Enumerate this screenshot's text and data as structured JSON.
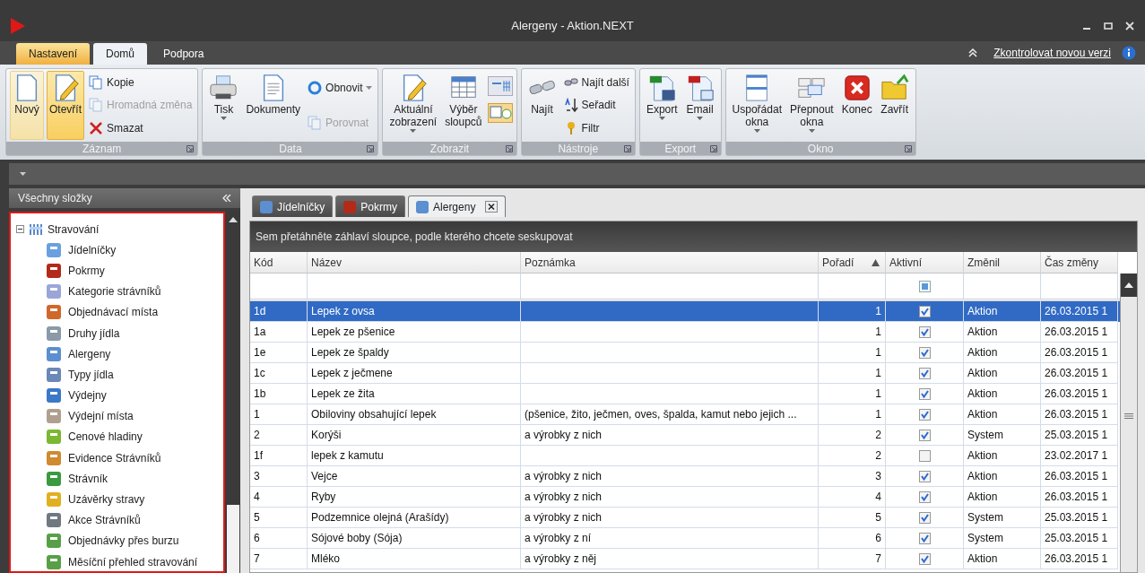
{
  "window": {
    "title": "Alergeny - Aktion.NEXT"
  },
  "ribbon_tabs": [
    {
      "label": "Nastavení",
      "selected": false,
      "contextual": true
    },
    {
      "label": "Domů",
      "selected": true,
      "contextual": false
    },
    {
      "label": "Podpora",
      "selected": false,
      "contextual": false
    }
  ],
  "update_link": "Zkontrolovat novou verzi",
  "ribbon_groups": [
    {
      "title": "Záznam",
      "buttons": [
        {
          "kind": "large",
          "label": "Nový",
          "hot": true,
          "pressed": false,
          "dropdown": false,
          "disabled": false
        },
        {
          "kind": "large",
          "label": "Otevřít",
          "hot": false,
          "pressed": true,
          "dropdown": false,
          "disabled": false
        },
        {
          "kind": "small",
          "label": "Kopie",
          "dropdown": false,
          "disabled": false
        },
        {
          "kind": "small",
          "label": "Hromadná změna",
          "dropdown": false,
          "disabled": true
        },
        {
          "kind": "small",
          "label": "Smazat",
          "dropdown": false,
          "disabled": false
        }
      ]
    },
    {
      "title": "Data",
      "buttons": [
        {
          "kind": "large",
          "label": "Tisk",
          "hot": false,
          "pressed": false,
          "dropdown": true,
          "disabled": false
        },
        {
          "kind": "large",
          "label": "Dokumenty",
          "hot": false,
          "pressed": false,
          "dropdown": false,
          "disabled": false
        },
        {
          "kind": "small",
          "label": "Obnovit",
          "dropdown": true,
          "disabled": false
        },
        {
          "kind": "small",
          "label": "Porovnat",
          "dropdown": false,
          "disabled": true
        }
      ]
    },
    {
      "title": "Zobrazit",
      "buttons": [
        {
          "kind": "large",
          "label": "Aktuální\nzobrazení",
          "hot": false,
          "pressed": false,
          "dropdown": true,
          "disabled": false
        },
        {
          "kind": "large",
          "label": "Výběr\nsloupců",
          "hot": false,
          "pressed": false,
          "dropdown": false,
          "disabled": false
        },
        {
          "kind": "iconpair"
        }
      ]
    },
    {
      "title": "Nástroje",
      "buttons": [
        {
          "kind": "large",
          "label": "Najít",
          "hot": false,
          "pressed": false,
          "dropdown": false,
          "disabled": false
        },
        {
          "kind": "small",
          "label": "Najít další",
          "dropdown": false,
          "disabled": false
        },
        {
          "kind": "small",
          "label": "Seřadit",
          "dropdown": false,
          "disabled": false
        },
        {
          "kind": "small",
          "label": "Filtr",
          "dropdown": false,
          "disabled": false
        }
      ]
    },
    {
      "title": "Export",
      "buttons": [
        {
          "kind": "large",
          "label": "Export",
          "hot": false,
          "pressed": false,
          "dropdown": true,
          "disabled": false
        },
        {
          "kind": "large",
          "label": "Email",
          "hot": false,
          "pressed": false,
          "dropdown": true,
          "disabled": false
        }
      ]
    },
    {
      "title": "Okno",
      "buttons": [
        {
          "kind": "large",
          "label": "Uspořádat\nokna",
          "hot": false,
          "pressed": false,
          "dropdown": true,
          "disabled": false
        },
        {
          "kind": "large",
          "label": "Přepnout\nokna",
          "hot": false,
          "pressed": false,
          "dropdown": true,
          "disabled": false
        },
        {
          "kind": "large",
          "label": "Konec",
          "hot": false,
          "pressed": false,
          "dropdown": false,
          "disabled": false
        },
        {
          "kind": "large",
          "label": "Zavřít",
          "hot": false,
          "pressed": false,
          "dropdown": false,
          "disabled": false
        }
      ]
    }
  ],
  "sidebar": {
    "title": "Všechny složky",
    "tree": [
      {
        "label": "Stravování",
        "expanded": true,
        "children": [
          {
            "label": "Jídelníčky"
          },
          {
            "label": "Pokrmy"
          },
          {
            "label": "Kategorie strávníků"
          },
          {
            "label": "Objednávací místa"
          },
          {
            "label": "Druhy jídla"
          },
          {
            "label": "Alergeny"
          },
          {
            "label": "Typy jídla"
          },
          {
            "label": "Výdejny"
          },
          {
            "label": "Výdejní místa"
          },
          {
            "label": "Cenové hladiny"
          },
          {
            "label": "Evidence Strávníků"
          },
          {
            "label": "Strávník"
          },
          {
            "label": "Uzávěrky stravy"
          },
          {
            "label": "Akce Strávníků"
          },
          {
            "label": "Objednávky přes burzu"
          },
          {
            "label": "Měsíční přehled stravování"
          }
        ]
      }
    ]
  },
  "doc_tabs": [
    {
      "label": "Jídelníčky",
      "selected": false,
      "closable": false
    },
    {
      "label": "Pokrmy",
      "selected": false,
      "closable": false
    },
    {
      "label": "Alergeny",
      "selected": true,
      "closable": true
    }
  ],
  "group_panel": "Sem přetáhněte záhlaví sloupce, podle kterého chcete seskupovat",
  "table": {
    "columns": [
      {
        "label": "Kód",
        "sorted": false
      },
      {
        "label": "Název",
        "sorted": false
      },
      {
        "label": "Poznámka",
        "sorted": false
      },
      {
        "label": "Pořadí",
        "sorted": true
      },
      {
        "label": "Aktivní",
        "sorted": false
      },
      {
        "label": "Změnil",
        "sorted": false
      },
      {
        "label": "Čas změny",
        "sorted": false
      }
    ],
    "filter_active_indeterminate": true,
    "rows": [
      {
        "code": "1d",
        "name": "Lepek z ovsa",
        "note": "",
        "order": "1",
        "active": true,
        "changed_by": "Aktion",
        "changed_at": "26.03.2015 1",
        "selected": true
      },
      {
        "code": "1a",
        "name": "Lepek ze pšenice",
        "note": "",
        "order": "1",
        "active": true,
        "changed_by": "Aktion",
        "changed_at": "26.03.2015 1",
        "selected": false
      },
      {
        "code": "1e",
        "name": "Lepek ze špaldy",
        "note": "",
        "order": "1",
        "active": true,
        "changed_by": "Aktion",
        "changed_at": "26.03.2015 1",
        "selected": false
      },
      {
        "code": "1c",
        "name": "Lepek z ječmene",
        "note": "",
        "order": "1",
        "active": true,
        "changed_by": "Aktion",
        "changed_at": "26.03.2015 1",
        "selected": false
      },
      {
        "code": "1b",
        "name": "Lepek ze žita",
        "note": "",
        "order": "1",
        "active": true,
        "changed_by": "Aktion",
        "changed_at": "26.03.2015 1",
        "selected": false
      },
      {
        "code": "1",
        "name": "Obiloviny obsahující lepek",
        "note": "(pšenice, žito, ječmen, oves, špalda, kamut nebo jejich ...",
        "order": "1",
        "active": true,
        "changed_by": "Aktion",
        "changed_at": "26.03.2015 1",
        "selected": false
      },
      {
        "code": "2",
        "name": "Korýši",
        "note": "a výrobky z nich",
        "order": "2",
        "active": true,
        "changed_by": "System",
        "changed_at": "25.03.2015 1",
        "selected": false
      },
      {
        "code": "1f",
        "name": "lepek z kamutu",
        "note": "",
        "order": "2",
        "active": false,
        "changed_by": "Aktion",
        "changed_at": "23.02.2017 1",
        "selected": false
      },
      {
        "code": "3",
        "name": "Vejce",
        "note": "a výrobky z nich",
        "order": "3",
        "active": true,
        "changed_by": "Aktion",
        "changed_at": "26.03.2015 1",
        "selected": false
      },
      {
        "code": "4",
        "name": "Ryby",
        "note": "a výrobky z nich",
        "order": "4",
        "active": true,
        "changed_by": "Aktion",
        "changed_at": "26.03.2015 1",
        "selected": false
      },
      {
        "code": "5",
        "name": "Podzemnice olejná (Arašídy)",
        "note": "a výrobky z nich",
        "order": "5",
        "active": true,
        "changed_by": "System",
        "changed_at": "25.03.2015 1",
        "selected": false
      },
      {
        "code": "6",
        "name": "Sójové boby (Sója)",
        "note": "a výrobky z ní",
        "order": "6",
        "active": true,
        "changed_by": "System",
        "changed_at": "25.03.2015 1",
        "selected": false
      },
      {
        "code": "7",
        "name": "Mléko",
        "note": "a výrobky z něj",
        "order": "7",
        "active": true,
        "changed_by": "Aktion",
        "changed_at": "26.03.2015 1",
        "selected": false
      }
    ]
  }
}
